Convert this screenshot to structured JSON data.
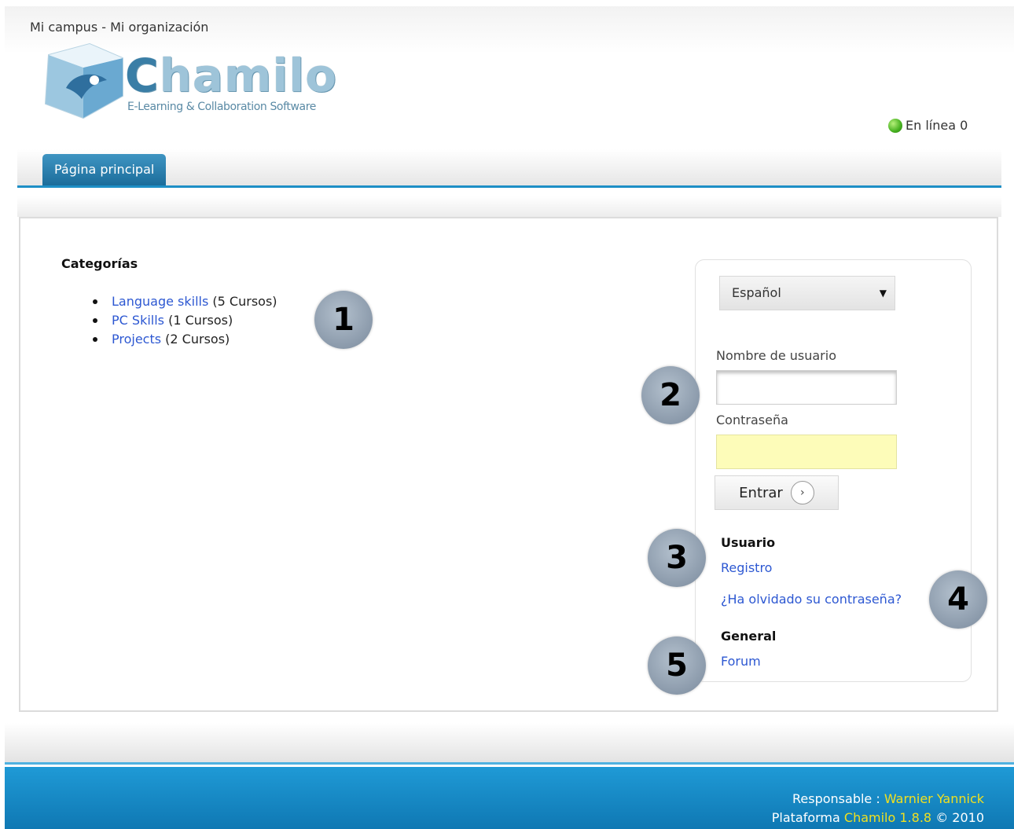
{
  "header": {
    "site_name": "Mi campus - Mi organización",
    "logo_word_first": "C",
    "logo_word_rest": "hamilo",
    "logo_tagline": "E-Learning & Collaboration Software",
    "online_label": "En línea 0"
  },
  "nav": {
    "tabs": [
      {
        "label": "Página principal",
        "active": true
      }
    ],
    "accent_color": "#1e8fc6"
  },
  "categories": {
    "title": "Categorías",
    "items": [
      {
        "name": "Language skills",
        "count": "(5 Cursos)"
      },
      {
        "name": "PC Skills",
        "count": "(1 Cursos)"
      },
      {
        "name": "Projects",
        "count": "(2 Cursos)"
      }
    ]
  },
  "login": {
    "language": "Español",
    "username_label": "Nombre de usuario",
    "username_value": "",
    "password_label": "Contraseña",
    "submit_label": "Entrar",
    "user_section_title": "Usuario",
    "register_link": "Registro",
    "forgot_link": "¿Ha olvidado su contraseña?",
    "general_section_title": "General",
    "forum_link": "Forum"
  },
  "callouts": [
    "1",
    "2",
    "3",
    "4",
    "5"
  ],
  "footer": {
    "responsible_label": "Responsable :",
    "responsible_name": "Warnier Yannick",
    "platform_label": "Plataforma",
    "platform_name": "Chamilo 1.8.8",
    "copyright": "© 2010",
    "highlight_color": "#f0e020"
  },
  "icons": [
    "online-dot-icon",
    "dropdown-arrow-icon",
    "arrow-right-icon",
    "chamilo-cube-icon"
  ]
}
